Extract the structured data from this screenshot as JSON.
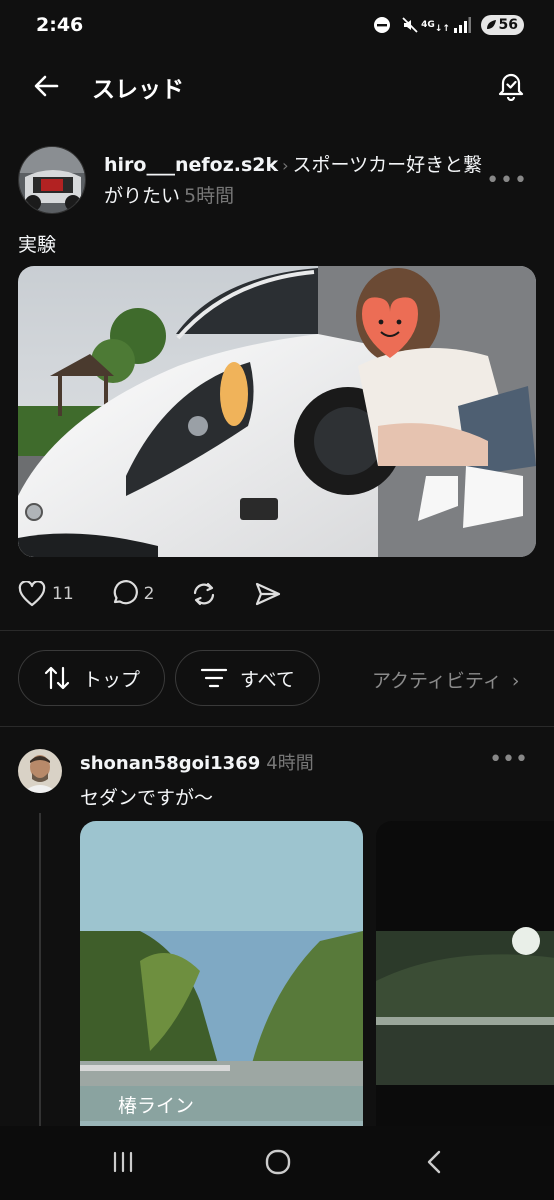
{
  "status": {
    "time": "2:46",
    "network": "4G",
    "battery": "56"
  },
  "header": {
    "title": "スレッド"
  },
  "post": {
    "username": "hiro___nefoz.s2k",
    "community": "スポーツカー好きと繋がりたい",
    "time": "5時間",
    "text": "実験",
    "likes": "11",
    "comments": "2"
  },
  "filters": {
    "sort_label": "トップ",
    "filter_label": "すべて",
    "activity_label": "アクティビティ"
  },
  "reply": {
    "username": "shonan58goi1369",
    "time": "4時間",
    "text": "セダンですが〜",
    "media_caption": "椿ライン"
  },
  "icons": [
    "arrow-left-icon",
    "bell-check-icon",
    "heart-icon",
    "comment-icon",
    "repost-icon",
    "send-icon",
    "sort-icon",
    "filter-icon",
    "chevron-right-icon",
    "more-icon",
    "recents-icon",
    "home-icon",
    "back-nav-icon"
  ]
}
